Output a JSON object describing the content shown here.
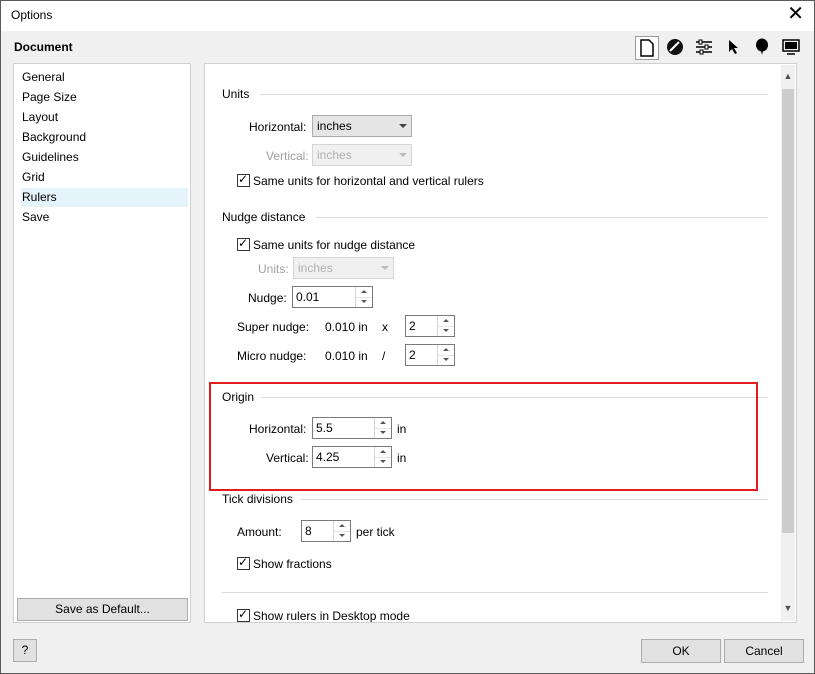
{
  "window": {
    "title": "Options",
    "close_symbol": "✕"
  },
  "section_title": "Document",
  "toolbar_icons": [
    "document-icon",
    "color-icon",
    "settings-icon",
    "pointer-icon",
    "balloon-icon",
    "display-icon"
  ],
  "nav": {
    "items": [
      "General",
      "Page Size",
      "Layout",
      "Background",
      "Guidelines",
      "Grid",
      "Rulers",
      "Save"
    ],
    "selected": "Rulers",
    "save_default": "Save as Default..."
  },
  "units": {
    "title": "Units",
    "horizontal_label": "Horizontal:",
    "horizontal_value": "inches",
    "vertical_label": "Vertical:",
    "vertical_value": "inches",
    "same_units_label": "Same units for horizontal and vertical rulers",
    "same_units_checked": true
  },
  "nudge": {
    "title": "Nudge distance",
    "same_units_label": "Same units for nudge distance",
    "same_units_checked": true,
    "units_label": "Units:",
    "units_value": "inches",
    "nudge_label": "Nudge:",
    "nudge_value": "0.01",
    "super_label": "Super nudge:",
    "super_value": "0.010 in",
    "super_op": "x",
    "super_mult": "2",
    "micro_label": "Micro nudge:",
    "micro_value": "0.010 in",
    "micro_op": "/",
    "micro_div": "2"
  },
  "origin": {
    "title": "Origin",
    "horizontal_label": "Horizontal:",
    "horizontal_value": "5.5",
    "vertical_label": "Vertical:",
    "vertical_value": "4.25",
    "unit": "in"
  },
  "tick": {
    "title": "Tick divisions",
    "amount_label": "Amount:",
    "amount_value": "8",
    "per_tick": "per tick",
    "fractions_label": "Show fractions",
    "fractions_checked": true
  },
  "desktop_rulers_label": "Show rulers in Desktop mode",
  "desktop_rulers_checked": true,
  "footer": {
    "help": "?",
    "ok": "OK",
    "cancel": "Cancel"
  },
  "colors": {
    "highlight": "#e11d1d",
    "selected_nav": "#e5f3fb"
  }
}
